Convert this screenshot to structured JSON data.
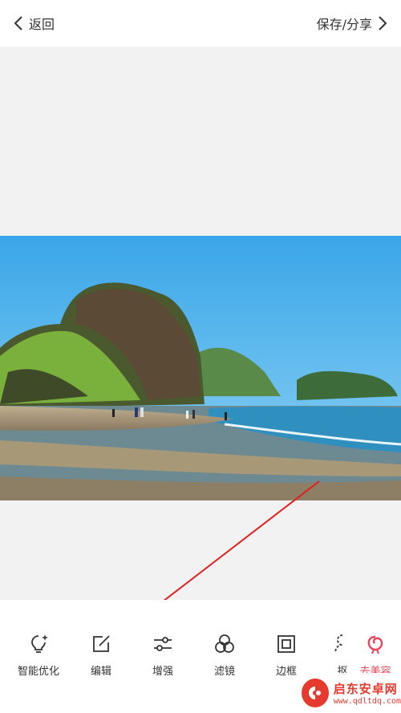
{
  "header": {
    "back_label": "返回",
    "save_label": "保存/分享"
  },
  "toolbar": {
    "tools": [
      {
        "label": "智能优化",
        "icon": "bulb-sparkle-icon"
      },
      {
        "label": "编辑",
        "icon": "edit-square-icon"
      },
      {
        "label": "增强",
        "icon": "sliders-icon"
      },
      {
        "label": "滤镜",
        "icon": "filter-circles-icon"
      },
      {
        "label": "边框",
        "icon": "frame-icon"
      },
      {
        "label": "抠",
        "icon": "cutout-icon"
      },
      {
        "label": "去美容",
        "icon": "meiyan-icon"
      }
    ]
  },
  "annotation": {
    "arrow_color": "#e02020"
  },
  "watermark": {
    "title": "启东安卓网",
    "url": "www.qdltdq.com"
  },
  "colors": {
    "canvas_bg": "#f2f2f2",
    "sky": "#4fb3ea",
    "accent": "#e8455a"
  }
}
